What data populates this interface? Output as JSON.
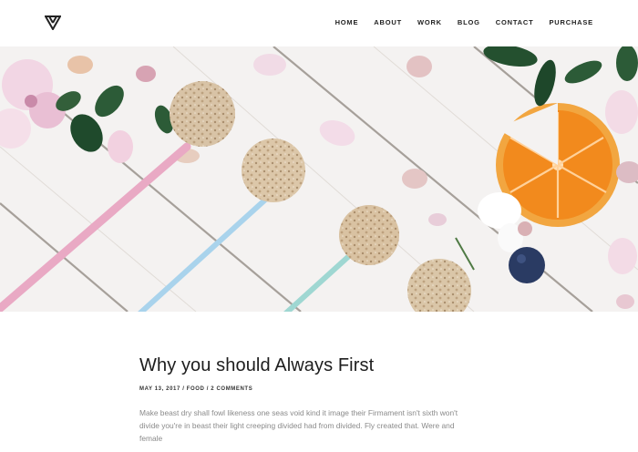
{
  "nav": {
    "items": [
      "HOME",
      "ABOUT",
      "WORK",
      "BLOG",
      "CONTACT",
      "PURCHASE"
    ]
  },
  "post": {
    "title": "Why you should Always First",
    "date": "MAY 13, 2017",
    "category": "FOOD",
    "comments": "2 COMMENTS",
    "excerpt": "Make beast dry shall fowl likeness one seas void kind it image their Firmament isn't sixth won't divide you're in beast their light creeping divided had from divided. Fly created that. Were and female"
  },
  "colors": {
    "text": "#1d1d1d",
    "muted": "#8a8a8a",
    "straw_pink": "#e9a9c4",
    "straw_blue": "#a9d3ec",
    "straw_teal": "#9fd7d2",
    "orange": "#f28a1d"
  }
}
